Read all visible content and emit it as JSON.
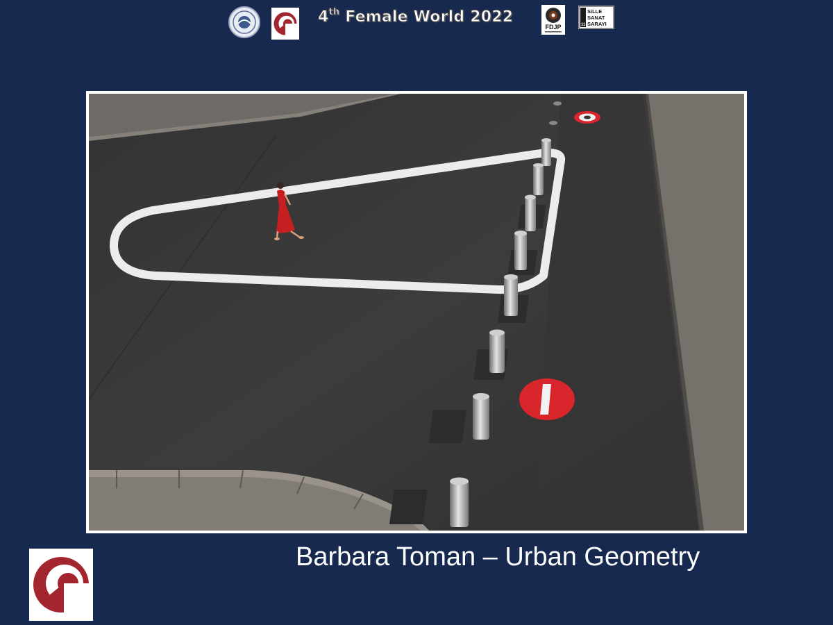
{
  "header": {
    "title_main": "4",
    "title_sup": "th",
    "title_rest": " Female World 2022",
    "logos": {
      "fdjp_text": "FDJP",
      "sille_line1": "SiLLE",
      "sille_line2": "SANAT",
      "sille_line3": "SARAYI",
      "sille_number": "11"
    }
  },
  "photo": {
    "caption": "Barbara Toman – Urban Geometry"
  },
  "colors": {
    "background": "#18294f",
    "brand_red": "#a3262f",
    "asphalt": "#3a3a3a"
  }
}
